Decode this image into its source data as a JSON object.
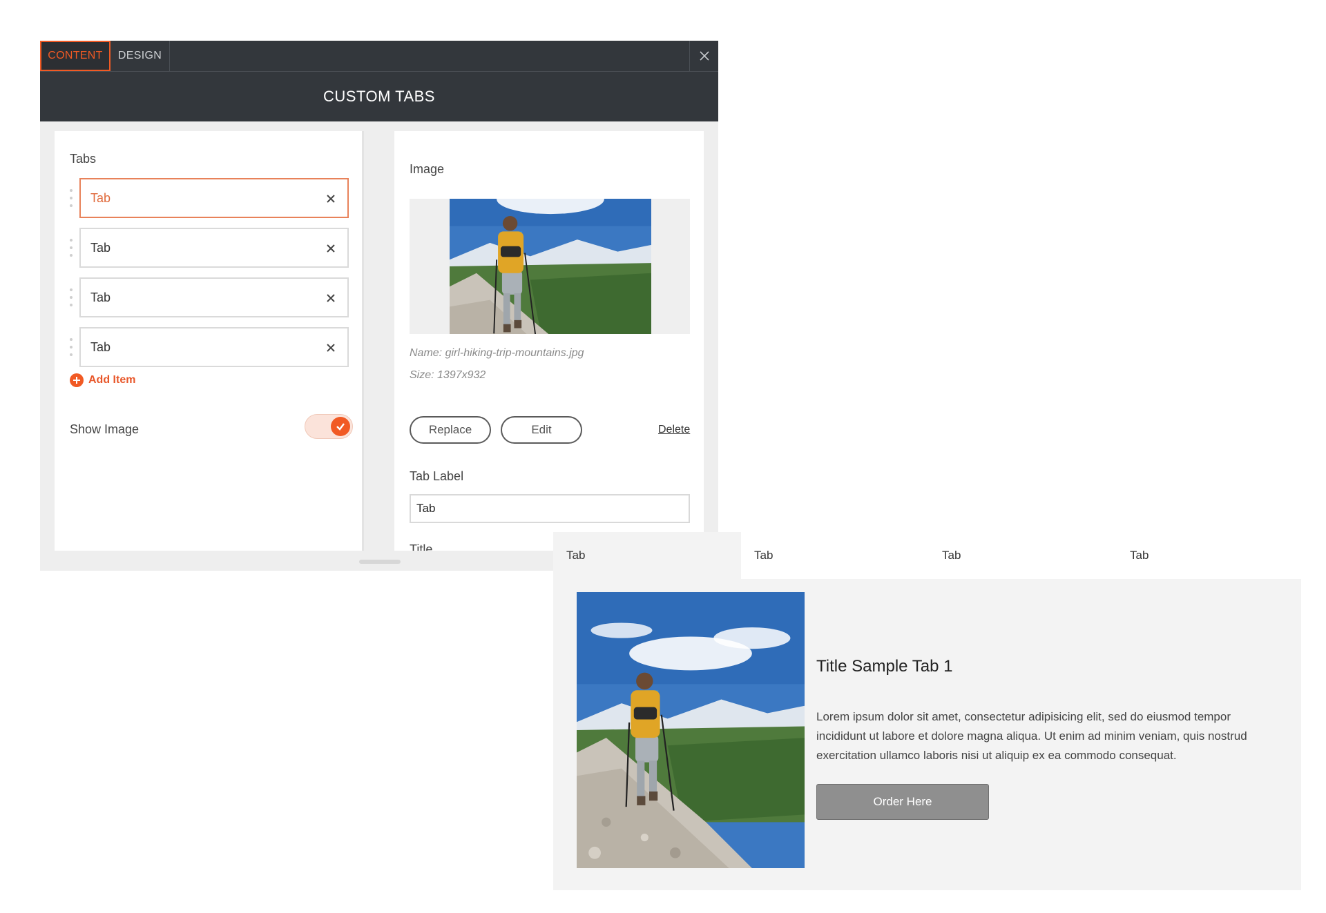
{
  "editor": {
    "tabs": [
      {
        "label": "CONTENT",
        "active": true
      },
      {
        "label": "DESIGN",
        "active": false
      }
    ],
    "title": "CUSTOM TABS",
    "left": {
      "section_label": "Tabs",
      "items": [
        {
          "label": "Tab",
          "active": true
        },
        {
          "label": "Tab",
          "active": false
        },
        {
          "label": "Tab",
          "active": false
        },
        {
          "label": "Tab",
          "active": false
        }
      ],
      "add_item_label": "Add Item",
      "show_image_label": "Show Image",
      "show_image_enabled": true
    },
    "right": {
      "section_label": "Image",
      "image_name": "Name: girl-hiking-trip-mountains.jpg",
      "image_size": "Size: 1397x932",
      "replace_label": "Replace",
      "edit_label": "Edit",
      "delete_label": "Delete",
      "tab_label_label": "Tab Label",
      "tab_label_value": "Tab",
      "title_label": "Title"
    }
  },
  "preview": {
    "tabs": [
      "Tab",
      "Tab",
      "Tab",
      "Tab"
    ],
    "title": "Title Sample Tab 1",
    "body": "Lorem ipsum dolor sit amet, consectetur adipisicing elit, sed do eiusmod tempor incididunt ut labore et dolore magna aliqua. Ut enim ad minim veniam, quis nostrud exercitation ullamco laboris nisi ut aliquip ex ea commodo consequat.",
    "button_label": "Order Here"
  },
  "colors": {
    "accent": "#f15a24",
    "dark_bar": "#33373c",
    "panel_bg": "#eeeeee",
    "button_gray": "#8f8f8f"
  },
  "icons": {
    "close": "close-icon",
    "remove": "remove-icon",
    "drag": "drag-handle-icon",
    "add": "plus-circle-icon",
    "check": "check-icon"
  }
}
